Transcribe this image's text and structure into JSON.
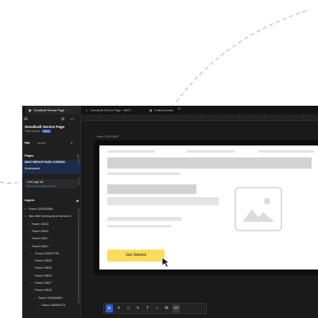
{
  "tabs": [
    {
      "label": "Snovikraft Service Page",
      "active": true
    },
    {
      "label": "Snovikraft Service Page - 980Cl",
      "active": false
    },
    {
      "label": "Polished leads",
      "active": false
    }
  ],
  "sidebar": {
    "project_title": "Snovikraft Service Page",
    "team_label": "Team project",
    "team_badge": "Free",
    "tab_file": "File",
    "tab_assets": "Assets",
    "pages_heading": "Pages",
    "selected_page": "SNOV SERVICE PAGE UI DESIGN",
    "selected_page_sub": "Development",
    "warning_line1": "1 free page left",
    "warning_line2": "Get unlimited pages & more",
    "layers_heading": "Layers",
    "layers": [
      {
        "label": "Frame 1000000659",
        "glyph": "#",
        "indent": 0
      },
      {
        "label": "New Web Development Service UI",
        "glyph": "#",
        "indent": 0
      },
      {
        "label": "Frame 20815",
        "glyph": "::",
        "indent": 1
      },
      {
        "label": "Frame 20816",
        "glyph": "::",
        "indent": 1
      },
      {
        "label": "Frame 20817",
        "glyph": "::",
        "indent": 1
      },
      {
        "label": "Frame 20812",
        "glyph": "::",
        "indent": 1
      },
      {
        "label": "Group 1000007736",
        "glyph": "::",
        "indent": 2
      },
      {
        "label": "Frame 20825",
        "glyph": "::",
        "indent": 2
      },
      {
        "label": "Frame 20828",
        "glyph": "::",
        "indent": 2
      },
      {
        "label": "Frame 20829",
        "glyph": "::",
        "indent": 2
      },
      {
        "label": "Frame 20827",
        "glyph": "::",
        "indent": 2
      },
      {
        "label": "Frame 20823",
        "glyph": "::",
        "indent": 2
      },
      {
        "label": "Frame 1000000815",
        "glyph": "::",
        "indent": 3
      },
      {
        "label": "Frame 1000000772",
        "glyph": "::",
        "indent": 4
      }
    ]
  },
  "canvas": {
    "frame_label": "Frame 1000000659",
    "cta_label": "Get Started"
  },
  "colors": {
    "accent": "#2f5fd6",
    "cta": "#fcdc5a",
    "app_bg": "#1b1b1b"
  },
  "toolbar": {
    "tools": [
      "move-tool-icon",
      "frame-tool-icon",
      "shape-tool-icon",
      "pen-tool-icon",
      "text-tool-icon",
      "comment-tool-icon",
      "actions-tool-icon",
      "dev-mode-icon"
    ]
  }
}
